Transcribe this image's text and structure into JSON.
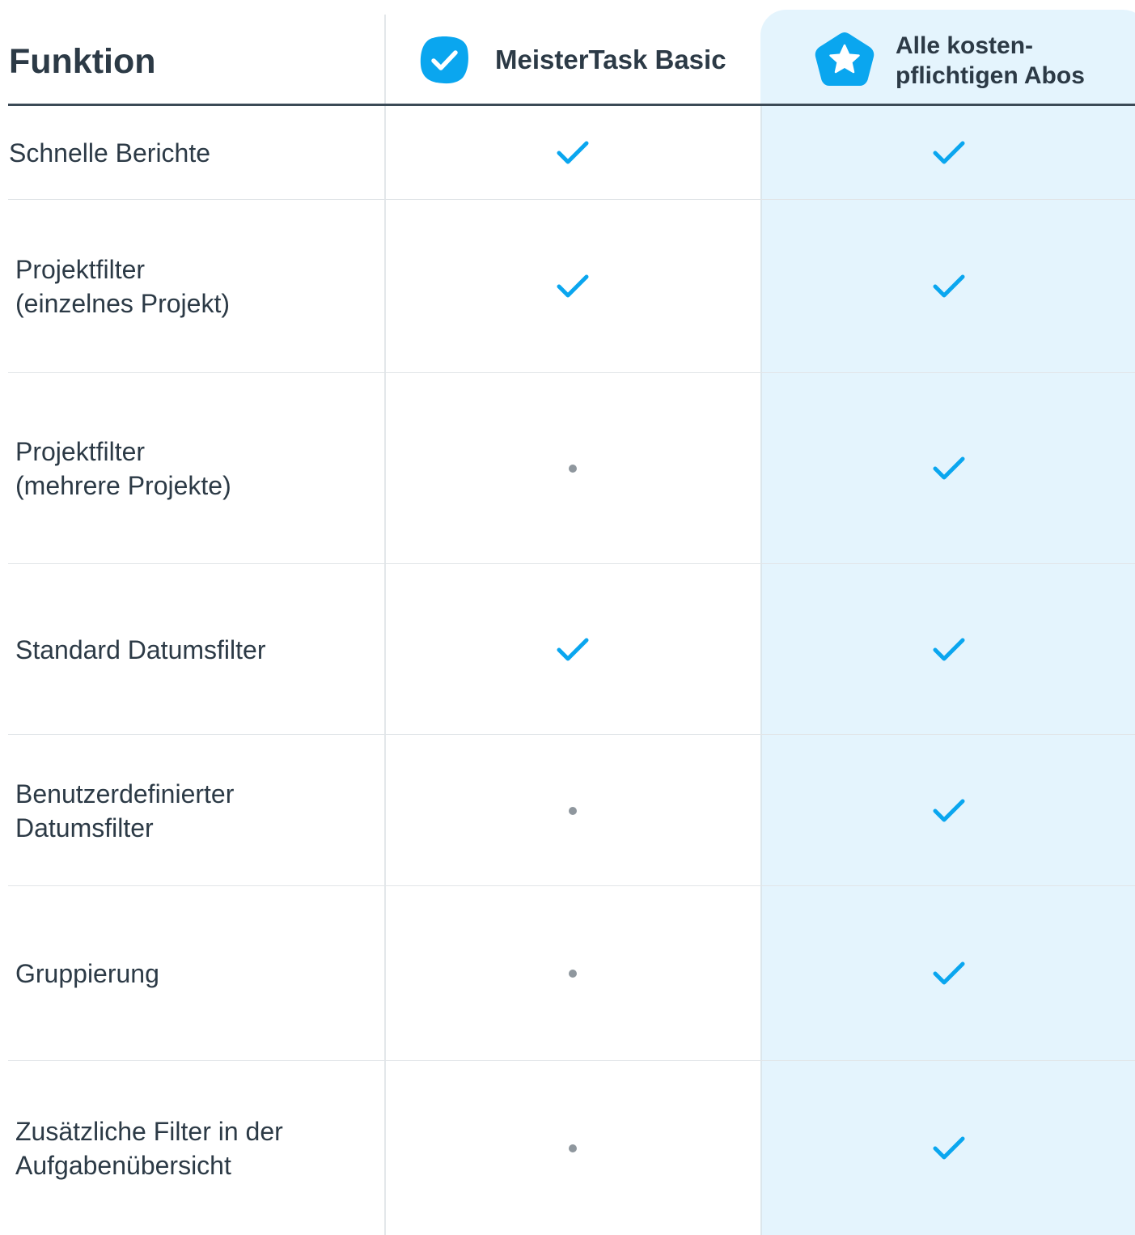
{
  "header": {
    "title": "Funktion",
    "plans": [
      {
        "label_lines": [
          "MeisterTask Basic"
        ],
        "icon": "check-badge-icon"
      },
      {
        "label_lines": [
          "Alle kosten-",
          "pflichtigen Abos"
        ],
        "icon": "star-badge-icon"
      }
    ]
  },
  "colors": {
    "accent": "#0aa6ef",
    "highlight_bg": "#e4f4fd",
    "text": "#2c3a46",
    "dot": "#8f979e"
  },
  "rows": [
    {
      "feature_lines": [
        "Schnelle Berichte"
      ],
      "basic": "check",
      "paid": "check"
    },
    {
      "feature_lines": [
        "Projektfilter",
        "(einzelnes Projekt)"
      ],
      "basic": "check",
      "paid": "check"
    },
    {
      "feature_lines": [
        "Projektfilter",
        "(mehrere Projekte)"
      ],
      "basic": "none",
      "paid": "check"
    },
    {
      "feature_lines": [
        "Standard Datumsfilter"
      ],
      "basic": "check",
      "paid": "check"
    },
    {
      "feature_lines": [
        "Benutzerdefinierter",
        "Datumsfilter"
      ],
      "basic": "none",
      "paid": "check"
    },
    {
      "feature_lines": [
        "Gruppierung"
      ],
      "basic": "none",
      "paid": "check"
    },
    {
      "feature_lines": [
        "Zusätzliche Filter in der",
        "Aufgabenübersicht"
      ],
      "basic": "none",
      "paid": "check"
    }
  ]
}
